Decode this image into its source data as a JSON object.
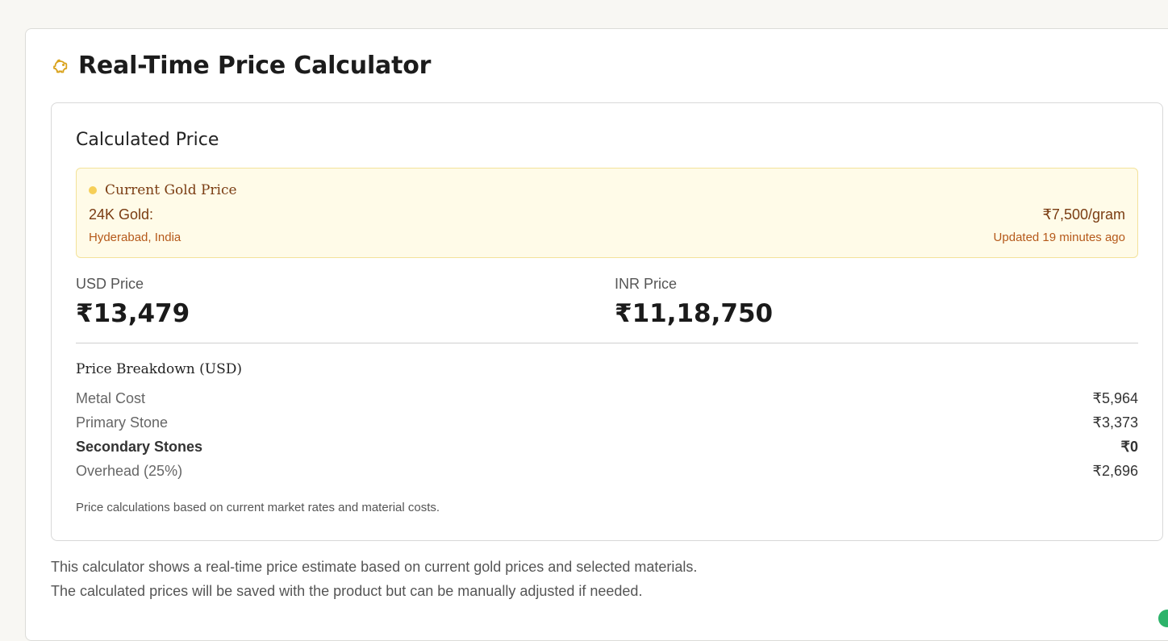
{
  "header": {
    "title": "Real-Time Price Calculator",
    "icon": "piggy-bank-icon",
    "icon_color": "#d9a21b"
  },
  "calc": {
    "title": "Calculated Price",
    "gold": {
      "heading": "Current Gold Price",
      "label": "24K Gold:",
      "value": "₹7,500/gram",
      "location": "Hyderabad, India",
      "updated": "Updated 19 minutes ago"
    },
    "usd": {
      "label": "USD Price",
      "value": "₹13,479"
    },
    "inr": {
      "label": "INR Price",
      "value": "₹11,18,750"
    },
    "breakdown": {
      "title": "Price Breakdown (USD)",
      "rows": [
        {
          "label": "Metal Cost",
          "value": "₹5,964"
        },
        {
          "label": "Primary Stone",
          "value": "₹3,373"
        },
        {
          "label": "Secondary Stones",
          "value": "₹0"
        },
        {
          "label": "Overhead (25%)",
          "value": "₹2,696"
        }
      ]
    },
    "note": "Price calculations based on current market rates and material costs."
  },
  "footer": {
    "line1": "This calculator shows a real-time price estimate based on current gold prices and selected materials.",
    "line2": "The calculated prices will be saved with the product but can be manually adjusted if needed."
  },
  "colors": {
    "accent": "#d9a21b",
    "gold_bg": "#fffbe8",
    "gold_border": "#f3e29a",
    "gold_text": "#7a3c12",
    "gold_subtext": "#b5591a"
  }
}
